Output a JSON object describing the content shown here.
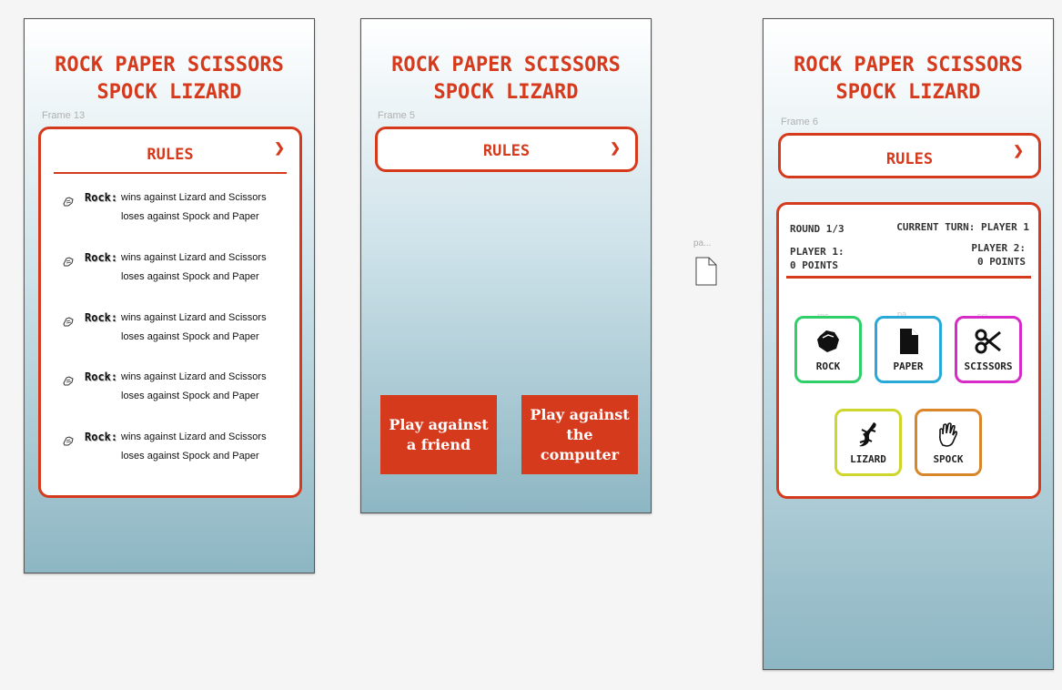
{
  "title_line1": "ROCK PAPER SCISSORS",
  "title_line2": "SPOCK LIZARD",
  "frames": {
    "rules_frame": {
      "label": "Frame 13"
    },
    "menu_frame": {
      "label": "Frame 5"
    },
    "game_frame": {
      "label": "Frame 6"
    }
  },
  "rules": {
    "heading": "RULES",
    "items": [
      {
        "name": "Rock:",
        "wins": "wins against Lizard and Scissors",
        "loses": "loses against Spock and Paper"
      },
      {
        "name": "Rock:",
        "wins": "wins against Lizard and Scissors",
        "loses": "loses against Spock and Paper"
      },
      {
        "name": "Rock:",
        "wins": "wins against Lizard and Scissors",
        "loses": "loses against Spock and Paper"
      },
      {
        "name": "Rock:",
        "wins": "wins against Lizard and Scissors",
        "loses": "loses against Spock and Paper"
      },
      {
        "name": "Rock:",
        "wins": "wins against Lizard and Scissors",
        "loses": "loses against Spock and Paper"
      }
    ]
  },
  "menu": {
    "play_friend": "Play against a friend",
    "play_computer": "Play against the computer"
  },
  "side_asset": {
    "label": "pa...",
    "icon": "document-icon"
  },
  "game": {
    "round": "ROUND 1/3",
    "current_turn": "CURRENT TURN: PLAYER 1",
    "player1_name": "PLAYER 1:",
    "player1_points": "0 POINTS",
    "player2_name": "PLAYER 2:",
    "player2_points": "0 POINTS",
    "choices": [
      {
        "label": "ROCK",
        "color": "#2fcf6a",
        "tag": "roc..."
      },
      {
        "label": "PAPER",
        "color": "#29a9d8",
        "tag": "pa..."
      },
      {
        "label": "SCISSORS",
        "color": "#d62bc9",
        "tag": "sci..."
      },
      {
        "label": "LIZARD",
        "color": "#cfd62b",
        "tag": ""
      },
      {
        "label": "SPOCK",
        "color": "#d9862b",
        "tag": ""
      }
    ]
  },
  "colors": {
    "accent": "#d63a1d"
  }
}
